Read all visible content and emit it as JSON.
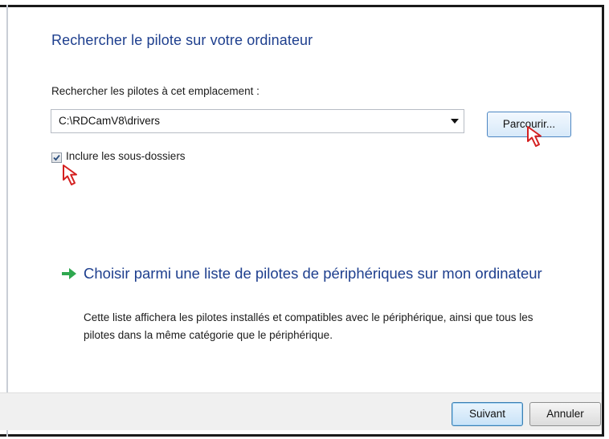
{
  "dialog": {
    "title": "Rechercher le pilote sur votre ordinateur",
    "location_label": "Rechercher les pilotes à cet emplacement :",
    "path_value": "C:\\RDCamV8\\drivers",
    "browse_label": "Parcourir...",
    "include_subfolders_label": "Inclure les sous-dossiers",
    "include_subfolders_checked": true
  },
  "option": {
    "title": "Choisir parmi une liste de pilotes de périphériques sur mon ordinateur",
    "description": "Cette liste affichera les pilotes installés et compatibles avec le périphérique, ainsi que tous les pilotes dans la même catégorie que le périphérique."
  },
  "footer": {
    "next_label": "Suivant",
    "cancel_label": "Annuler"
  },
  "colors": {
    "heading": "#1e3f8e",
    "arrow": "#2fa84f",
    "cursor_outline": "#d42020"
  },
  "icons": {
    "option_arrow": "green-arrow-icon",
    "pointer": "pointer-cursor-icon",
    "dropdown": "chevron-down-icon",
    "checkmark": "checkmark-icon"
  }
}
